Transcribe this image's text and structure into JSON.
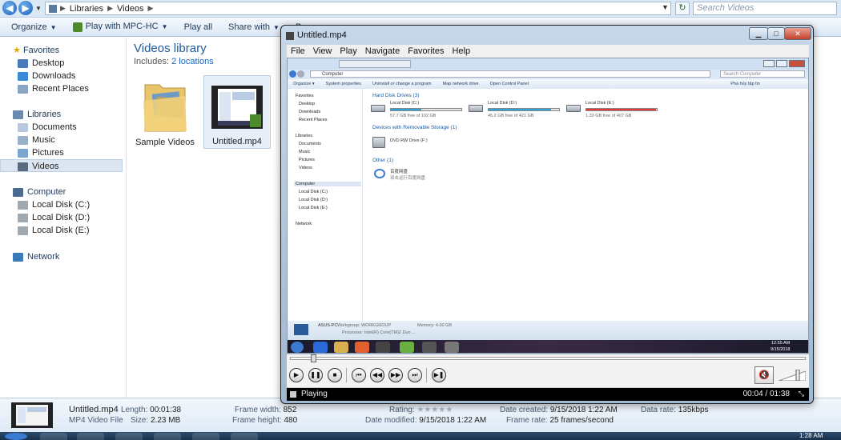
{
  "explorer": {
    "breadcrumb": [
      "Libraries",
      "Videos"
    ],
    "search_placeholder": "Search Videos",
    "toolbar": [
      "Organize",
      "Play with MPC-HC",
      "Play all",
      "Share with",
      "Bu"
    ],
    "sidebar": {
      "favorites_header": "Favorites",
      "favorites": [
        "Desktop",
        "Downloads",
        "Recent Places"
      ],
      "libraries_header": "Libraries",
      "libraries": [
        "Documents",
        "Music",
        "Pictures",
        "Videos"
      ],
      "computer_header": "Computer",
      "computer": [
        "Local Disk (C:)",
        "Local Disk (D:)",
        "Local Disk (E:)"
      ],
      "network": "Network"
    },
    "library_title": "Videos library",
    "includes_label": "Includes:",
    "includes_link": "2 locations",
    "files": [
      "Sample Videos",
      "Untitled.mp4"
    ],
    "details": {
      "name": "Untitled.mp4",
      "type": "MP4 Video File",
      "length_label": "Length:",
      "length": "00:01:38",
      "size_label": "Size:",
      "size": "2.23 MB",
      "fw_label": "Frame width:",
      "fw": "852",
      "fh_label": "Frame height:",
      "fh": "480",
      "rating_label": "Rating:",
      "modified_label": "Date modified:",
      "modified": "9/15/2018 1:22 AM",
      "created_label": "Date created:",
      "created": "9/15/2018 1:22 AM",
      "framerate_label": "Frame rate:",
      "framerate": "25 frames/second",
      "datarate_label": "Data rate:",
      "datarate": "135kbps"
    },
    "clock": "1:28 AM"
  },
  "player": {
    "title": "Untitled.mp4",
    "menu": [
      "File",
      "View",
      "Play",
      "Navigate",
      "Favorites",
      "Help"
    ],
    "status": "Playing",
    "time": "00:04 / 01:38",
    "seek_fraction": 0.045,
    "video_frame": {
      "address": "Computer",
      "search": "Search Computer",
      "toolbar": [
        "Organize ▾",
        "System properties",
        "Uninstall or change a program",
        "Map network drive",
        "Open Control Panel"
      ],
      "toolbar_right": "Phá hủy tập tin",
      "sidebar": [
        "Favorites",
        "Desktop",
        "Downloads",
        "Recent Places",
        "Libraries",
        "Documents",
        "Music",
        "Pictures",
        "Videos",
        "Computer",
        "Local Disk (C:)",
        "Local Disk (D:)",
        "Local Disk (E:)",
        "Network"
      ],
      "hdd_header": "Hard Disk Drives (3)",
      "disks": [
        {
          "name": "Local Disk (C:)",
          "free": "57.7 GB free of 102 GB",
          "used": 0.43,
          "color": "#2ea3dc"
        },
        {
          "name": "Local Disk (D:)",
          "free": "45.2 GB free of 421 GB",
          "used": 0.89,
          "color": "#2ea3dc"
        },
        {
          "name": "Local Disk (E:)",
          "free": "1.33 GB free of 407 GB",
          "used": 0.99,
          "color": "#e53a3a"
        }
      ],
      "removable_header": "Devices with Removable Storage (1)",
      "dvd": "DVD RW Drive (F:)",
      "other_header": "Other (1)",
      "other_name": "百度网盘",
      "other_sub": "双击运行百度网盘",
      "status_pc": "ASUS-PC",
      "status_wg": "Workgroup: WORKGROUP",
      "status_mem": "Memory: 4.00 GB",
      "status_cpu": "Processor: Intel(R) Core(TM)2 Duo ...",
      "tray_time": "12:55 AM",
      "tray_date": "9/15/2018"
    }
  }
}
